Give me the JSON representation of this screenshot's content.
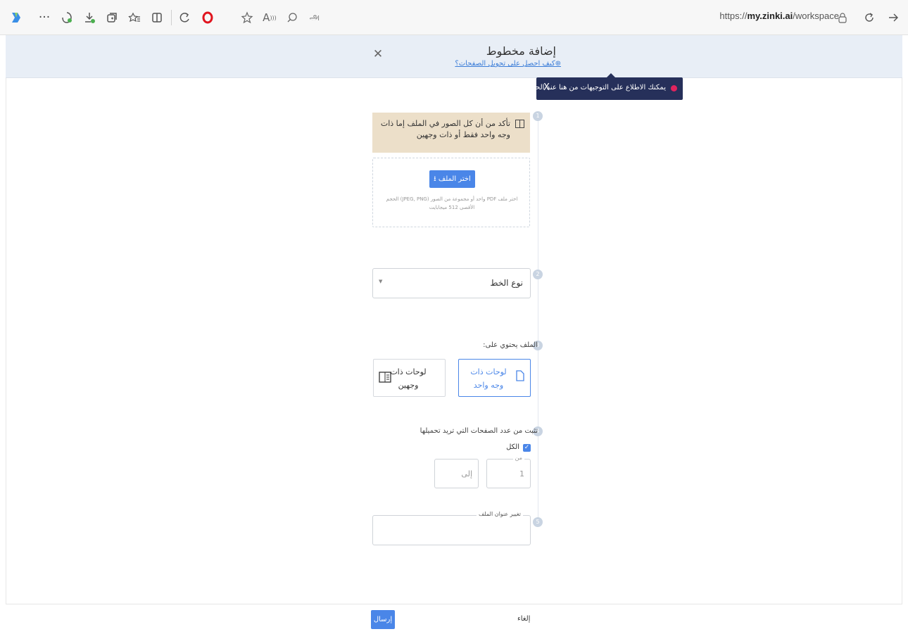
{
  "browser": {
    "url_prefix": "https://",
    "url_domain": "my.zinki.ai",
    "url_path": "/workspace",
    "icons": [
      "copilot-icon",
      "more-icon",
      "extensions-icon",
      "downloads-icon",
      "collections-icon",
      "favorites-icon",
      "split-screen-icon",
      "sync-icon",
      "opera-icon",
      "star-icon",
      "read-aloud-icon",
      "zoom-icon",
      "translate-icon"
    ],
    "more_glyph": "···",
    "translate_glyph": "அ"
  },
  "dialog": {
    "title": "إضافة مخطوط",
    "help_link": "كيف احصل على تحويل الصفحات؟"
  },
  "tooltip": {
    "text": "يمكنك الاطلاع على التوجيهات من هنا عند الحاجة."
  },
  "steps": {
    "notice": "تأكد من أن كل الصور في الملف إما ذات وجه واحد فقط أو ذات وجهين",
    "upload_button": "اختر الملف",
    "upload_hint": "اختر ملف PDF واحد أو مجموعة من الصور (JPEG, PNG) الحجم الأقصى 512 ميجابايت",
    "font_type": "نوع الخط",
    "contents_label": "الملف يحتوي على:",
    "option_single": "لوحات ذات وجه واحد",
    "option_double": "لوحات ذات وجهين",
    "pages_label": "تثبت من عدد الصفحات التي تريد تحميلها",
    "all_label": "الكل",
    "from_label": "من",
    "from_value": "1",
    "to_placeholder": "إلى",
    "rename_label": "تغيير عنوان الملف",
    "numbers": [
      "1",
      "2",
      "3",
      "4",
      "5"
    ]
  },
  "footer": {
    "send": "إرسال",
    "cancel": "إلغاء"
  },
  "colors": {
    "primary": "#4a86e8",
    "tooltip_bg": "#26305a",
    "notice_bg": "#ecdfc9",
    "header_bg": "#e8eef6"
  }
}
